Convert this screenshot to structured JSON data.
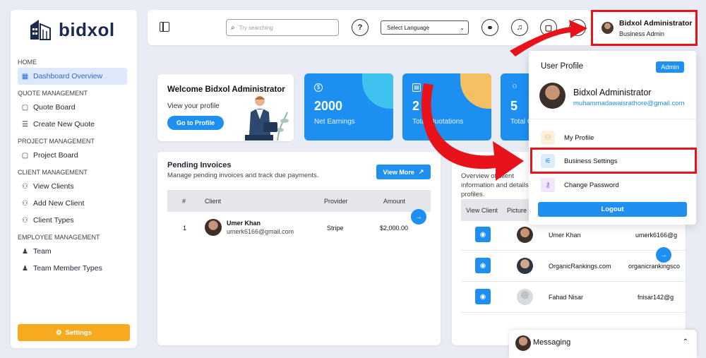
{
  "brand": {
    "name": "bidxol"
  },
  "sidebar": {
    "sections": [
      {
        "title": "HOME",
        "items": [
          {
            "label": "Dashboard Overview",
            "icon": "grid-icon",
            "active": true
          }
        ]
      },
      {
        "title": "QUOTE MANAGEMENT",
        "items": [
          {
            "label": "Quote Board",
            "icon": "clipboard-icon"
          },
          {
            "label": "Create New Quote",
            "icon": "database-icon"
          }
        ]
      },
      {
        "title": "PROJECT MANAGEMENT",
        "items": [
          {
            "label": "Project Board",
            "icon": "clipboard-icon"
          }
        ]
      },
      {
        "title": "CLIENT MANAGEMENT",
        "items": [
          {
            "label": "View Clients",
            "icon": "user-icon"
          },
          {
            "label": "Add New Client",
            "icon": "user-plus-icon"
          },
          {
            "label": "Client Types",
            "icon": "user-icon"
          }
        ]
      },
      {
        "title": "EMPLOYEE MANAGEMENT",
        "items": [
          {
            "label": "Team",
            "icon": "team-icon"
          },
          {
            "label": "Team Member Types",
            "icon": "team-icon"
          }
        ]
      }
    ],
    "settings_label": "Settings"
  },
  "topbar": {
    "search_placeholder": "Try searching",
    "language_label": "Select Language",
    "user_name": "Bidxol Administrator",
    "user_role": "Business Admin"
  },
  "welcome": {
    "title": "Welcome Bidxol Administrator",
    "subtitle": "View your profile",
    "button": "Go to Profile"
  },
  "stats": [
    {
      "value": "2000",
      "label": "Net Earnings",
      "icon": "$",
      "blob": "#3fc3ee"
    },
    {
      "value": "2",
      "label": "Total Quotations",
      "icon": "▤",
      "blob": "#f4c064"
    },
    {
      "value": "5",
      "label": "Total Clients",
      "icon": "⚇",
      "blob": "#7fd0f3"
    }
  ],
  "invoices": {
    "title": "Pending Invoices",
    "subtitle": "Manage pending invoices and track due payments.",
    "view_more": "View More",
    "headers": [
      "#",
      "Client",
      "Provider",
      "Amount"
    ],
    "rows": [
      {
        "num": "1",
        "name": "Umer Khan",
        "email": "umerk6166@gmail.com",
        "provider": "Stripe",
        "amount": "$2,000.00"
      }
    ]
  },
  "clients": {
    "desc": "Overview of client information and details profiles.",
    "headers": [
      "View Client",
      "Picture"
    ],
    "rows": [
      {
        "name": "Umer Khan",
        "email": "umerk6166@g"
      },
      {
        "name": "OrganicRankings.com",
        "email": "organicrankingsco"
      },
      {
        "name": "Fahad Nisar",
        "email": "fnisar142@g"
      }
    ]
  },
  "profile_menu": {
    "title": "User Profile",
    "badge": "Admin",
    "name": "Bidxol Administrator",
    "email": "muhammadawaisrathore@gmail.com",
    "items": [
      {
        "label": "My Profile",
        "icon": "user-icon",
        "bg": "#fdf0dc",
        "fg": "#e8a53a"
      },
      {
        "label": "Business Settings",
        "icon": "sliders-icon",
        "bg": "#dcedfb",
        "fg": "#2a8ae0"
      },
      {
        "label": "Change Password",
        "icon": "key-icon",
        "bg": "#f1e6fb",
        "fg": "#9b5de0"
      }
    ],
    "logout": "Logout"
  },
  "messaging": {
    "label": "Messaging"
  },
  "colors": {
    "primary": "#1f8ff0",
    "accent": "#f7aa1f",
    "highlight": "#e8121b"
  }
}
